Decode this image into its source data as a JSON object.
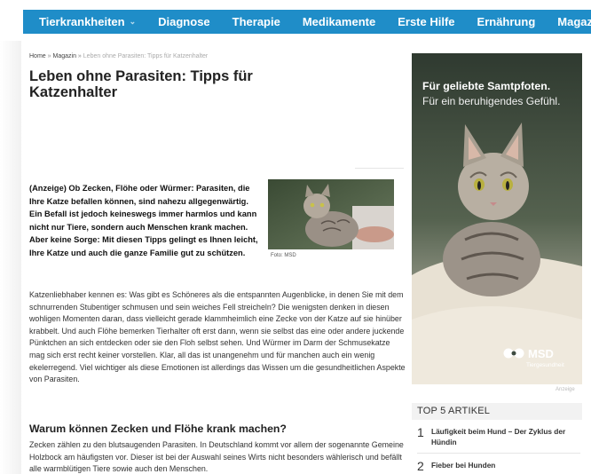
{
  "nav": {
    "items": [
      "Tierkrankheiten",
      "Diagnose",
      "Therapie",
      "Medikamente",
      "Erste Hilfe",
      "Ernährung",
      "Magazin"
    ],
    "dropdown_icon": "chevron-down-icon",
    "bar_color": "#1f8dc8"
  },
  "breadcrumb": {
    "home": "Home",
    "sep": "»",
    "section": "Magazin",
    "current": "Leben ohne Parasiten: Tipps für Katzenhalter"
  },
  "article": {
    "title": "Leben ohne Parasiten: Tipps für Katzenhalter",
    "lead": "(Anzeige) Ob Zecken, Flöhe oder Würmer: Parasiten, die Ihre Katze befallen können, sind nahezu allgegenwärtig. Ein Befall ist jedoch keineswegs immer harmlos und kann nicht nur Tiere, sondern auch Menschen krank machen. Aber keine Sorge: Mit diesen Tipps gelingt es Ihnen leicht, Ihre Katze und auch die ganze Familie gut zu schützen.",
    "photo_caption": "Foto: MSD",
    "body": "Katzenliebhaber kennen es: Was gibt es Schöneres als die entspannten Augenblicke, in denen Sie mit dem schnurrenden Stubentiger schmusen und sein weiches Fell streicheln? Die wenigsten denken in diesen wohligen Momenten daran, dass vielleicht gerade klammheimlich eine Zecke von der Katze auf sie hinüber krabbelt. Und auch Flöhe bemerken Tierhalter oft erst dann, wenn sie selbst das eine oder andere juckende Pünktchen an sich entdecken oder sie den Floh selbst sehen. Und Würmer im Darm der Schmusekatze mag sich erst recht keiner vorstellen. Klar, all das ist unangenehm und für manchen auch ein wenig ekelerregend. Viel wichtiger als diese Emotionen ist allerdings das Wissen um die gesundheitlichen Aspekte von Parasiten.",
    "section_heading": "Warum können Zecken und Flöhe krank machen?",
    "section_body": "Zecken zählen zu den blutsaugenden Parasiten. In Deutschland kommt vor allem der sogenannte Gemeine Holzbock am häufigsten vor. Dieser ist bei der Auswahl seines Wirts nicht besonders wählerisch und befällt alle warmblütigen Tiere sowie auch den Menschen."
  },
  "ad": {
    "headline": "Für geliebte Samtpfoten.",
    "subline": "Für ein beruhigendes Gefühl.",
    "brand": "MSD",
    "brand_tag": "Tiergesundheit",
    "label": "Anzeige"
  },
  "top5": {
    "title": "TOP 5 ARTIKEL",
    "items": [
      {
        "num": "1",
        "text": "Läufigkeit beim Hund – Der Zyklus der Hündin"
      },
      {
        "num": "2",
        "text": "Fieber bei Hunden"
      }
    ]
  }
}
